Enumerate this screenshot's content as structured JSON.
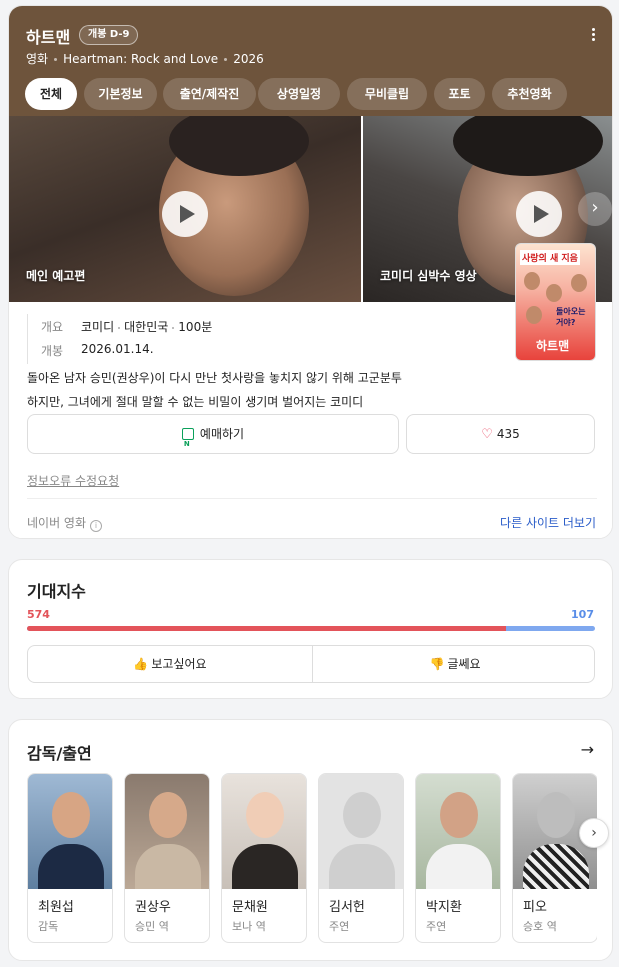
{
  "movie": {
    "title": "하트맨",
    "badge": "개봉 D-9",
    "category": "영화",
    "english_title": "Heartman: Rock and Love",
    "year": "2026",
    "tabs": [
      "전체",
      "기본정보",
      "출연/제작진",
      "상영일정",
      "무비클립",
      "포토",
      "추천영화"
    ],
    "videos": [
      {
        "label": "메인 예고편"
      },
      {
        "label": "코미디 심박수 영상"
      }
    ],
    "poster_text": {
      "top": "사랑의 새 지음",
      "mid": "돌아오는 거야?",
      "bottom": "하트맨"
    },
    "overview_label": "개요",
    "overview": {
      "genre": "코미디",
      "country": "대한민국",
      "runtime": "100분"
    },
    "release_label": "개봉",
    "release_date": "2026.01.14.",
    "synopsis_line1": "돌아온 남자 승민(권상우)이 다시 만난 첫사랑을 놓치지 않기 위해 고군분투",
    "synopsis_line2": "하지만, 그녀에게 절대 말할 수 없는 비밀이 생기며 벌어지는 코미디",
    "reserve_label": "예매하기",
    "like_count": "435",
    "report_label": "정보오류 수정요청",
    "source_label": "네이버 영화",
    "more_sites_label": "다른 사이트 더보기"
  },
  "expectation": {
    "title": "기대지수",
    "want": 574,
    "meh": 107,
    "want_label": "보고싶어요",
    "meh_label": "글쎄요",
    "colors": {
      "want": "#e3545a",
      "meh": "#5a8ee8"
    }
  },
  "cast": {
    "title": "감독/출연",
    "people": [
      {
        "name": "최원섭",
        "role": "감독"
      },
      {
        "name": "권상우",
        "role": "승민 역"
      },
      {
        "name": "문채원",
        "role": "보나 역"
      },
      {
        "name": "김서헌",
        "role": "주연"
      },
      {
        "name": "박지환",
        "role": "주연"
      },
      {
        "name": "피오",
        "role": "승호 역"
      }
    ]
  }
}
